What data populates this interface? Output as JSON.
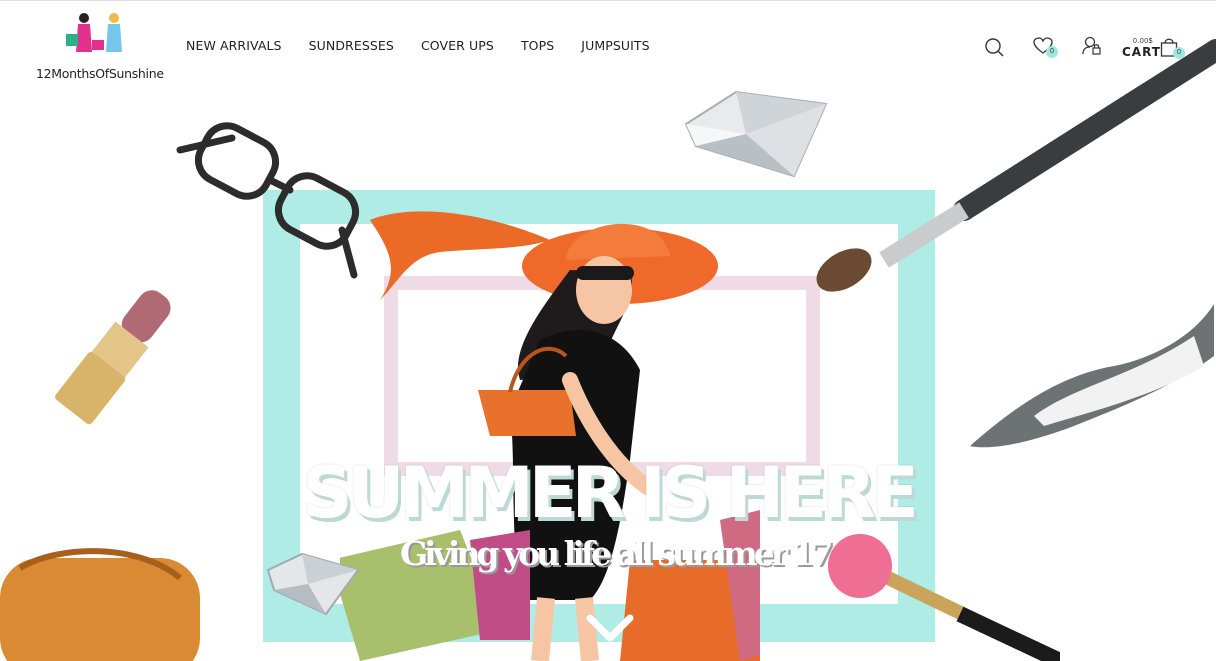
{
  "brand": {
    "name": "12MonthsOfSunshine"
  },
  "nav": [
    {
      "label": "NEW ARRIVALS"
    },
    {
      "label": "SUNDRESSES"
    },
    {
      "label": "COVER UPS"
    },
    {
      "label": "TOPS"
    },
    {
      "label": "JUMPSUITS"
    }
  ],
  "header_icons": {
    "search": "search-icon",
    "wishlist": "heart-icon",
    "wishlist_count": "0",
    "account": "user-lock-icon",
    "cart_price": "0.00$",
    "cart_label": "CART",
    "cart_count": "0"
  },
  "hero": {
    "title": "SUMMER IS HERE",
    "subtitle": "Giving you life all summer 17",
    "next_icon": "chevron-right-icon",
    "scroll_icon": "chevron-down-icon"
  },
  "colors": {
    "frame_teal": "#aeece5",
    "frame_pink": "#efdbe5",
    "badge": "#9fe7dd",
    "hat_orange": "#ef6a2a"
  }
}
